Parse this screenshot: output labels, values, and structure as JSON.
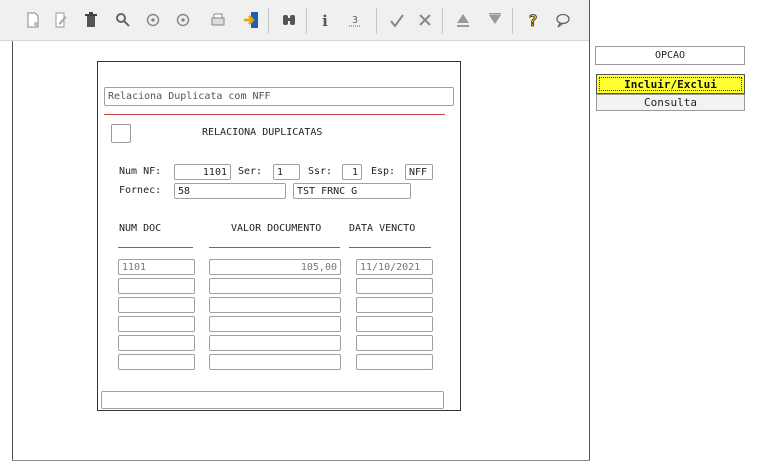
{
  "toolbar": {
    "icons": [
      "new-document-icon",
      "edit-icon",
      "trash-icon",
      "search-icon",
      "prev-icon",
      "next-icon",
      "print-icon",
      "exit-icon",
      "find-icon",
      "info-icon",
      "sum-icon",
      "confirm-icon",
      "cancel-icon",
      "up-icon",
      "down-icon",
      "help-icon",
      "comment-icon"
    ]
  },
  "form": {
    "title": "Relaciona Duplicata com NFF",
    "section_label": "RELACIONA DUPLICATAS",
    "num_nf_label": "Num NF:",
    "num_nf_value": "1101",
    "ser_label": "Ser:",
    "ser_value": "1",
    "ssr_label": "Ssr:",
    "ssr_value": "1",
    "esp_label": "Esp:",
    "esp_value": "NFF",
    "fornec_label": "Fornec:",
    "fornec_code": "58",
    "fornec_name": "TST FRNC G",
    "columns": {
      "num_doc": "NUM DOC",
      "valor": "VALOR DOCUMENTO",
      "data": "DATA VENCTO"
    },
    "rows": [
      {
        "num_doc": "1101",
        "valor": "105,00",
        "data": "11/10/2021"
      },
      {
        "num_doc": "",
        "valor": "",
        "data": ""
      },
      {
        "num_doc": "",
        "valor": "",
        "data": ""
      },
      {
        "num_doc": "",
        "valor": "",
        "data": ""
      },
      {
        "num_doc": "",
        "valor": "",
        "data": ""
      },
      {
        "num_doc": "",
        "valor": "",
        "data": ""
      }
    ],
    "status": ""
  },
  "options": {
    "header": "OPCAO",
    "items": [
      "Incluir/Exclui",
      "Consulta"
    ],
    "highlight_color": "#ffff33"
  }
}
